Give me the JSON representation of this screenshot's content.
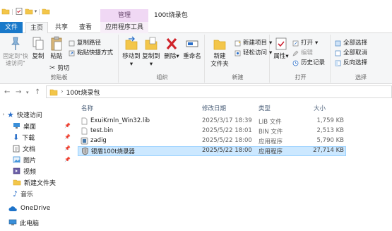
{
  "window": {
    "context_group": "管理",
    "title": "100t烧录包"
  },
  "tabs": {
    "file": "文件",
    "home": "主页",
    "share": "共享",
    "view": "查看",
    "app_tools": "应用程序工具"
  },
  "ribbon": {
    "clipboard": {
      "pin_quick": "固定到\"快速访问\"",
      "copy": "复制",
      "paste": "粘贴",
      "copy_path": "复制路径",
      "paste_shortcut": "粘贴快捷方式",
      "cut": "剪切",
      "label": "剪贴板"
    },
    "organize": {
      "move_to": "移动到",
      "copy_to": "复制到",
      "delete": "删除",
      "rename": "重命名",
      "label": "组织"
    },
    "new": {
      "new_folder": "新建\n文件夹",
      "new_item": "新建项目",
      "easy_access": "轻松访问",
      "label": "新建"
    },
    "open": {
      "properties": "属性",
      "open": "打开",
      "edit": "编辑",
      "history": "历史记录",
      "label": "打开"
    },
    "select": {
      "select_all": "全部选择",
      "select_none": "全部取消",
      "invert": "反向选择",
      "label": "选择"
    }
  },
  "address": {
    "path": "100t烧录包"
  },
  "nav": {
    "items": [
      {
        "label": "快速访问",
        "icon": "star-icon"
      },
      {
        "label": "桌面",
        "icon": "desktop-icon",
        "pinned": true
      },
      {
        "label": "下载",
        "icon": "download-icon",
        "pinned": true
      },
      {
        "label": "文档",
        "icon": "document-icon",
        "pinned": true
      },
      {
        "label": "图片",
        "icon": "picture-icon",
        "pinned": true
      },
      {
        "label": "视频",
        "icon": "video-icon"
      },
      {
        "label": "新建文件夹",
        "icon": "folder-icon"
      },
      {
        "label": "音乐",
        "icon": "music-icon"
      },
      {
        "label": "OneDrive",
        "icon": "cloud-icon"
      },
      {
        "label": "此电脑",
        "icon": "computer-icon"
      }
    ]
  },
  "files": {
    "headers": {
      "name": "名称",
      "modified": "修改日期",
      "type": "类型",
      "size": "大小"
    },
    "rows": [
      {
        "name": "ExuiKrnln_Win32.lib",
        "modified": "2025/3/17 18:39",
        "type": "LIB 文件",
        "size": "1,759 KB",
        "icon": "file-icon"
      },
      {
        "name": "test.bin",
        "modified": "2025/5/22 18:01",
        "type": "BIN 文件",
        "size": "2,513 KB",
        "icon": "file-icon"
      },
      {
        "name": "zadig",
        "modified": "2025/5/22 18:00",
        "type": "应用程序",
        "size": "5,790 KB",
        "icon": "app-icon"
      },
      {
        "name": "银盾100t烧录器",
        "modified": "2025/5/22 18:00",
        "type": "应用程序",
        "size": "27,714 KB",
        "icon": "shield-app-icon",
        "selected": true
      }
    ]
  },
  "colors": {
    "file_tab": "#1979ca",
    "context_tab": "#f0d8f4",
    "selection": "#cce8ff"
  }
}
